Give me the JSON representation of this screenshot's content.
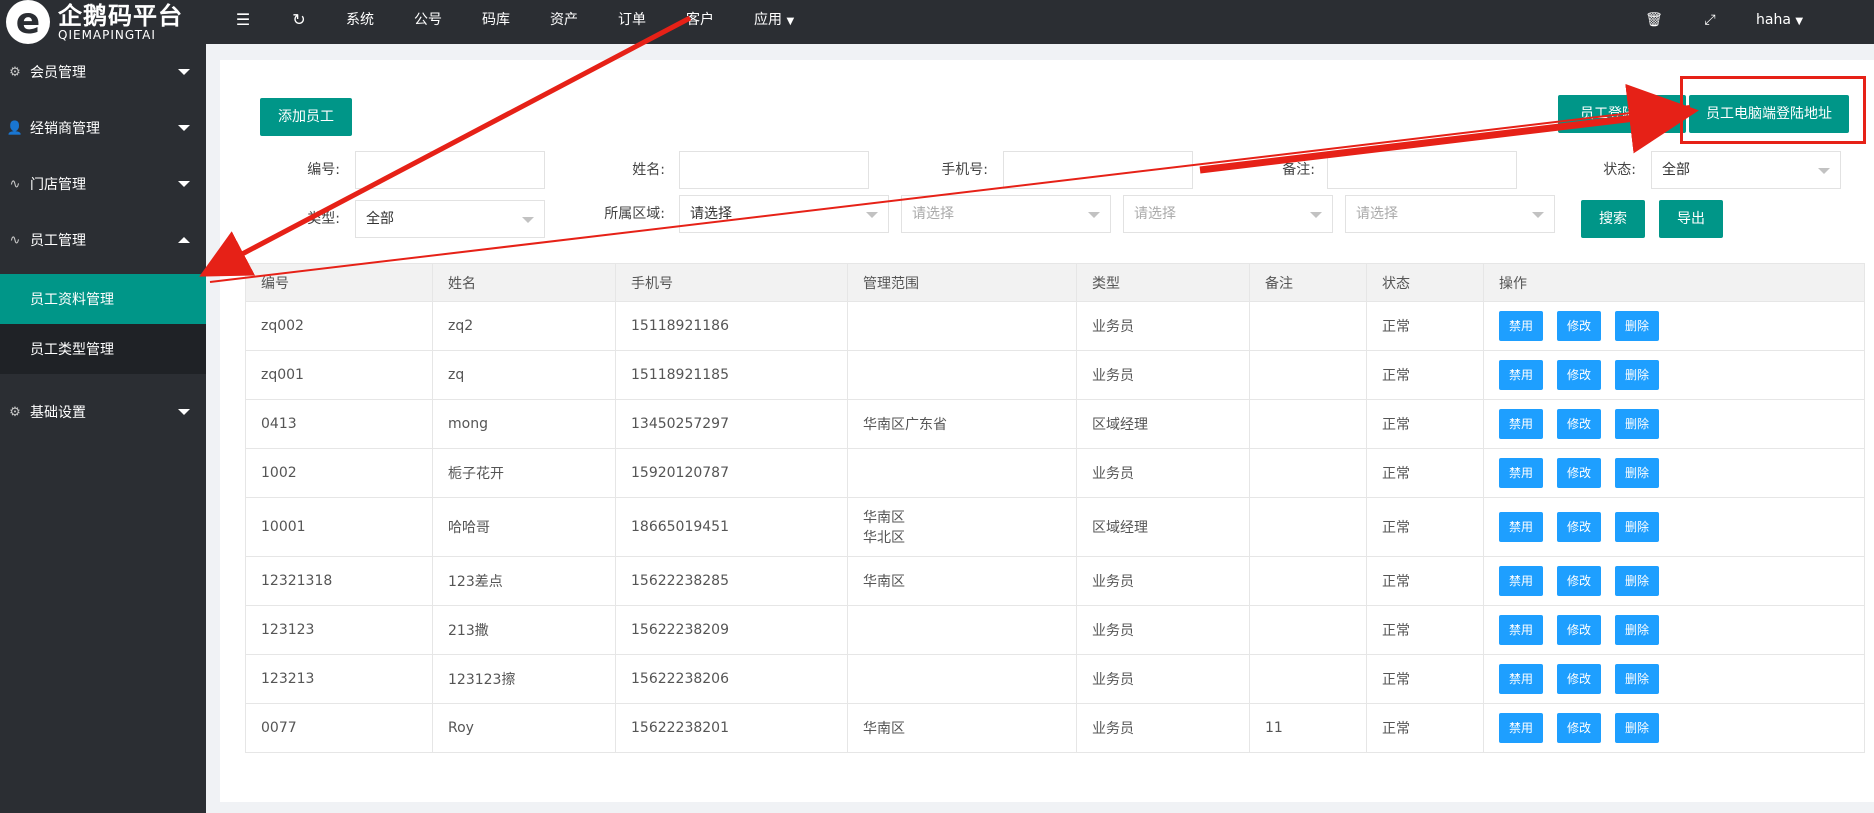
{
  "logo": {
    "mark": "e",
    "cn": "企鹅码平台",
    "en": "QIEMAPINGTAI"
  },
  "topbar": {
    "nav": [
      "系统",
      "公号",
      "码库",
      "资产",
      "订单",
      "客户",
      "应用"
    ],
    "user": "haha",
    "icons": [
      "menu-toggle-icon",
      "refresh-icon",
      "trash-icon",
      "fullscreen-icon"
    ]
  },
  "sidebar": {
    "items": [
      {
        "label": "会员管理",
        "icon": "gear-icon"
      },
      {
        "label": "经销商管理",
        "icon": "user-icon"
      },
      {
        "label": "门店管理",
        "icon": "pulse-icon"
      },
      {
        "label": "员工管理",
        "icon": "pulse-icon"
      },
      {
        "label": "基础设置",
        "icon": "gear-icon"
      }
    ],
    "sub": [
      "员工资料管理",
      "员工类型管理"
    ]
  },
  "toolbar": {
    "add": "添加员工",
    "login_url": "员工登陆地址",
    "pc_login_url": "员工电脑端登陆地址",
    "search": "搜索",
    "export": "导出"
  },
  "filters": {
    "code": "编号:",
    "name": "姓名:",
    "phone": "手机号:",
    "remark": "备注:",
    "status": "状态:",
    "status_value": "全部",
    "type": "类型:",
    "type_value": "全部",
    "region": "所属区域:",
    "region_value": "请选择",
    "placeholder": "请选择"
  },
  "table": {
    "headers": [
      "编号",
      "姓名",
      "手机号",
      "管理范围",
      "类型",
      "备注",
      "状态",
      "操作"
    ],
    "actions": [
      "禁用",
      "修改",
      "删除"
    ],
    "rows": [
      {
        "code": "zq002",
        "name": "zq2",
        "phone": "15118921186",
        "scope": "",
        "scope2": "",
        "type": "业务员",
        "remark": "",
        "status": "正常"
      },
      {
        "code": "zq001",
        "name": "zq",
        "phone": "15118921185",
        "scope": "",
        "scope2": "",
        "type": "业务员",
        "remark": "",
        "status": "正常"
      },
      {
        "code": "0413",
        "name": "mong",
        "phone": "13450257297",
        "scope": "华南区广东省",
        "scope2": "",
        "type": "区域经理",
        "remark": "",
        "status": "正常"
      },
      {
        "code": "1002",
        "name": "栀子花开",
        "phone": "15920120787",
        "scope": "",
        "scope2": "",
        "type": "业务员",
        "remark": "",
        "status": "正常"
      },
      {
        "code": "10001",
        "name": "哈哈哥",
        "phone": "18665019451",
        "scope": "华南区",
        "scope2": "华北区",
        "type": "区域经理",
        "remark": "",
        "status": "正常"
      },
      {
        "code": "12321318",
        "name": "123差点",
        "phone": "15622238285",
        "scope": "华南区",
        "scope2": "",
        "type": "业务员",
        "remark": "",
        "status": "正常"
      },
      {
        "code": "123123",
        "name": "213撒",
        "phone": "15622238209",
        "scope": "",
        "scope2": "",
        "type": "业务员",
        "remark": "",
        "status": "正常"
      },
      {
        "code": "123213",
        "name": "123123擦",
        "phone": "15622238206",
        "scope": "",
        "scope2": "",
        "type": "业务员",
        "remark": "",
        "status": "正常"
      },
      {
        "code": "0077",
        "name": "Roy",
        "phone": "15622238201",
        "scope": "华南区",
        "scope2": "",
        "type": "业务员",
        "remark": "11",
        "status": "正常"
      }
    ]
  },
  "colors": {
    "primary": "#009688",
    "action": "#1e9fff",
    "dark": "#2b2e33",
    "annotation": "#e62117"
  }
}
